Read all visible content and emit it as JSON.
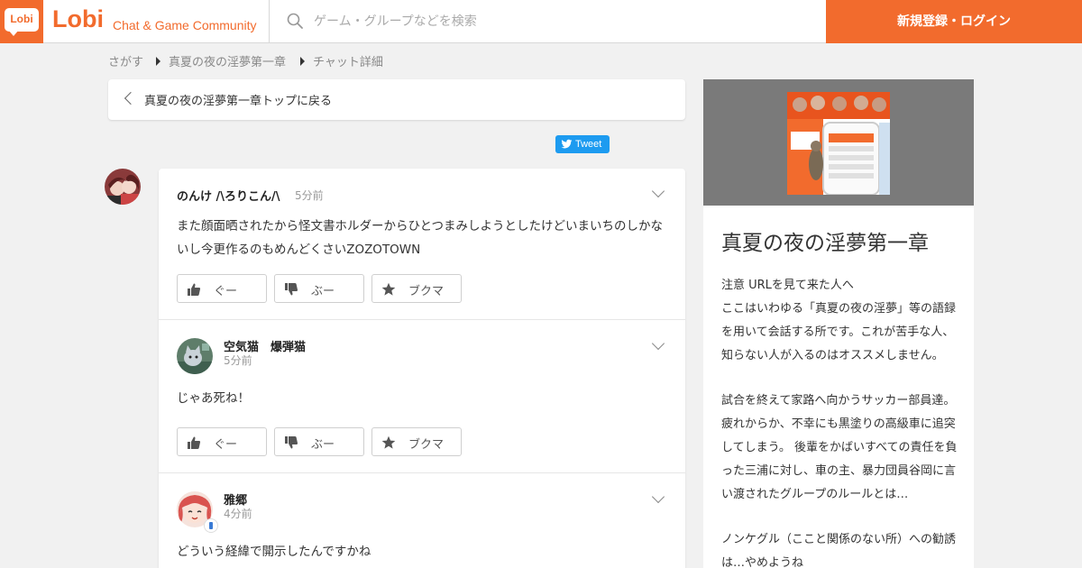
{
  "header": {
    "logo_text": "Lobi",
    "brand": "Lobi",
    "tagline": "Chat & Game Community",
    "search_placeholder": "ゲーム・グループなどを検索",
    "login_label": "新規登録・ログイン"
  },
  "breadcrumb": [
    "さがす",
    "真夏の夜の淫夢第一章",
    "チャット詳細"
  ],
  "back_label": "真夏の夜の淫夢第一章トップに戻る",
  "tweet_label": "Tweet",
  "actions": {
    "good": "ぐー",
    "boo": "ぶー",
    "bookmark": "ブクマ"
  },
  "messages": [
    {
      "user": "のんけ /\\ろりこん/\\",
      "time": "5分前",
      "text": "また顔面晒されたから怪文書ホルダーからひとつまみしようとしたけどいまいちのしかないし今更作るのもめんどくさいZOZOTOWN"
    },
    {
      "user": "空気猫　爆弾猫",
      "time": "5分前",
      "text": "じゃあ死ね！"
    },
    {
      "user": "雅郷",
      "time": "4分前",
      "text": "どういう経緯で開示したんですかね"
    }
  ],
  "sidebar": {
    "title": "真夏の夜の淫夢第一章",
    "desc1": "注意 URLを見て来た人へ\nここはいわゆる「真夏の夜の淫夢」等の語録を用いて会話する所です。これが苦手な人、知らない人が入るのはオススメしません。",
    "desc2": "試合を終えて家路へ向かうサッカー部員達。疲れからか、不幸にも黒塗りの高級車に追突してしまう。 後輩をかばいすべての責任を負った三浦に対し、車の主、暴力団員谷岡に言い渡されたグループのルールとは…",
    "desc3": "ノンケグル（ここと関係のない所）への勧誘は…やめようね"
  },
  "colors": {
    "brand": "#f26b2d",
    "tweet": "#1d9bf0"
  }
}
